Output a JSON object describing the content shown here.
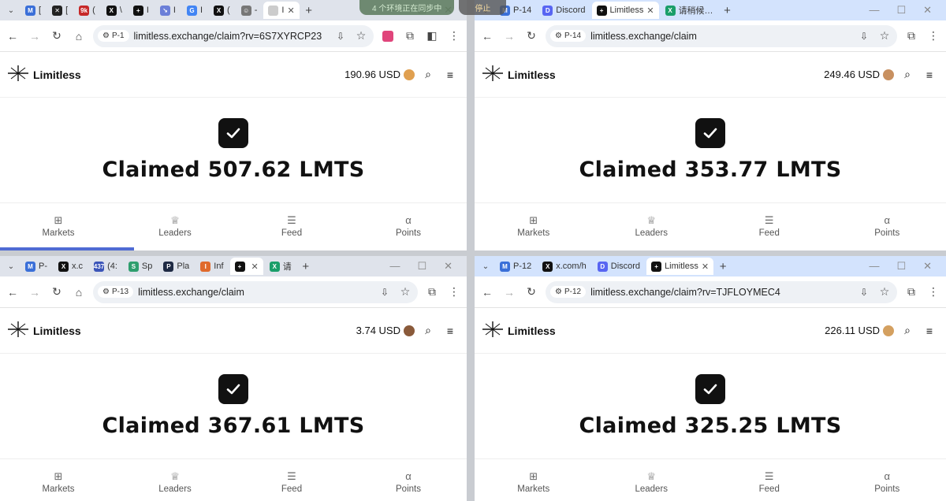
{
  "overlay": {
    "sync_text": "4 个环境正在同步中",
    "stop_label": "停止"
  },
  "windows": [
    {
      "tabs": [
        {
          "fav": "M",
          "color": "#3a6fd8",
          "title": "[",
          "active": false
        },
        {
          "fav": "✕",
          "color": "#222",
          "title": "[",
          "active": false
        },
        {
          "fav": "9k",
          "color": "#c62828",
          "title": "(",
          "active": false
        },
        {
          "fav": "X",
          "color": "#111",
          "title": "\\",
          "active": false
        },
        {
          "fav": "+",
          "color": "#111",
          "title": "I",
          "active": false
        },
        {
          "fav": "↘",
          "color": "#6b7fd8",
          "title": "I",
          "active": false
        },
        {
          "fav": "G",
          "color": "#4285f4",
          "title": "I",
          "active": false
        },
        {
          "fav": "X",
          "color": "#111",
          "title": "(",
          "active": false
        },
        {
          "fav": "☺",
          "color": "#777",
          "title": "-",
          "active": false
        },
        {
          "fav": "",
          "color": "#ccc",
          "title": "I",
          "active": true
        }
      ],
      "profile": "P-1",
      "url": "limitless.exchange/claim?rv=6S7XYRCP23",
      "balance": "190.96 USD",
      "avatar_color": "#e0a050",
      "claimed": "Claimed 507.62 LMTS",
      "ext": true,
      "progress": true
    },
    {
      "tabs": [
        {
          "fav": "M",
          "color": "#3a6fd8",
          "title": "P-14",
          "active": false
        },
        {
          "fav": "D",
          "color": "#5865f2",
          "title": "Discord",
          "active": false
        },
        {
          "fav": "+",
          "color": "#111",
          "title": "Limitless",
          "active": true
        },
        {
          "fav": "X",
          "color": "#1a9e6a",
          "title": "请稍候…",
          "active": false
        }
      ],
      "profile": "P-14",
      "url": "limitless.exchange/claim",
      "balance": "249.46 USD",
      "avatar_color": "#c89060",
      "claimed": "Claimed 353.77 LMTS",
      "ext": false,
      "progress": false
    },
    {
      "tabs": [
        {
          "fav": "M",
          "color": "#3a6fd8",
          "title": "P-",
          "active": false
        },
        {
          "fav": "X",
          "color": "#111",
          "title": "x.c",
          "active": false
        },
        {
          "fav": "437",
          "color": "#3b54b8",
          "title": "(4:",
          "active": false
        },
        {
          "fav": "S",
          "color": "#2e9e6e",
          "title": "Sp",
          "active": false
        },
        {
          "fav": "P",
          "color": "#1f2a44",
          "title": "Pla",
          "active": false
        },
        {
          "fav": "I",
          "color": "#e06a2c",
          "title": "Inf",
          "active": false
        },
        {
          "fav": "+",
          "color": "#111",
          "title": "",
          "active": true
        },
        {
          "fav": "X",
          "color": "#1a9e6a",
          "title": "请",
          "active": false
        }
      ],
      "profile": "P-13",
      "url": "limitless.exchange/claim",
      "balance": "3.74 USD",
      "avatar_color": "#8a5a3a",
      "claimed": "Claimed 367.61 LMTS",
      "ext": false,
      "progress": false
    },
    {
      "tabs": [
        {
          "fav": "M",
          "color": "#3a6fd8",
          "title": "P-12",
          "active": false
        },
        {
          "fav": "X",
          "color": "#111",
          "title": "x.com/h",
          "active": false
        },
        {
          "fav": "D",
          "color": "#5865f2",
          "title": "Discord",
          "active": false
        },
        {
          "fav": "+",
          "color": "#111",
          "title": "Limitless",
          "active": true
        }
      ],
      "profile": "P-12",
      "url": "limitless.exchange/claim?rv=TJFLOYMEC4",
      "balance": "226.11 USD",
      "avatar_color": "#d4a060",
      "claimed": "Claimed 325.25 LMTS",
      "ext": false,
      "progress": false
    }
  ],
  "site": {
    "brand": "Limitless",
    "nav": [
      {
        "icon": "grid-icon",
        "glyph": "⊞",
        "label": "Markets"
      },
      {
        "icon": "crown-icon",
        "glyph": "♕",
        "label": "Leaders"
      },
      {
        "icon": "feed-icon",
        "glyph": "☰",
        "label": "Feed"
      },
      {
        "icon": "alpha-icon",
        "glyph": "α",
        "label": "Points"
      }
    ]
  }
}
